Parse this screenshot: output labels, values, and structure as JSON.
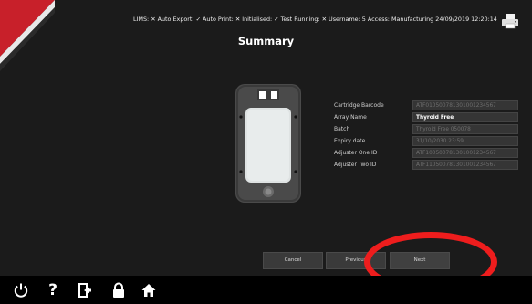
{
  "status": {
    "lims": "LIMS:",
    "auto_export": "Auto Export:",
    "auto_print": "Auto Print:",
    "initialised": "Initialised:",
    "test_running": "Test Running:",
    "username": "Username: 5",
    "access": "Access: Manufacturing",
    "datetime": "24/09/2019 12:20:14",
    "cross": "✕",
    "check": "✓"
  },
  "page_title": "Summary",
  "details": [
    {
      "label": "Cartridge Barcode",
      "value": "ATF010500781301001234567"
    },
    {
      "label": "Array Name",
      "value": "Thyroid Free"
    },
    {
      "label": "Batch",
      "value": "Thyroid Free 050078"
    },
    {
      "label": "Expiry date",
      "value": "31/10/2030 23:59"
    },
    {
      "label": "Adjuster One ID",
      "value": "ATF100500781301001234567"
    },
    {
      "label": "Adjuster Two ID",
      "value": "ATF110500781301001234567"
    }
  ],
  "buttons": {
    "cancel": "Cancel",
    "previous": "Previous",
    "next": "Next"
  },
  "nav_icons": [
    "power-icon",
    "help-icon",
    "logout-icon",
    "lock-icon",
    "home-icon"
  ],
  "nav_glyphs": {
    "help": "?"
  },
  "colors": {
    "accent_red": "#c8202a",
    "annotation_red": "#ee1d1d",
    "background": "#1b1b1b"
  }
}
